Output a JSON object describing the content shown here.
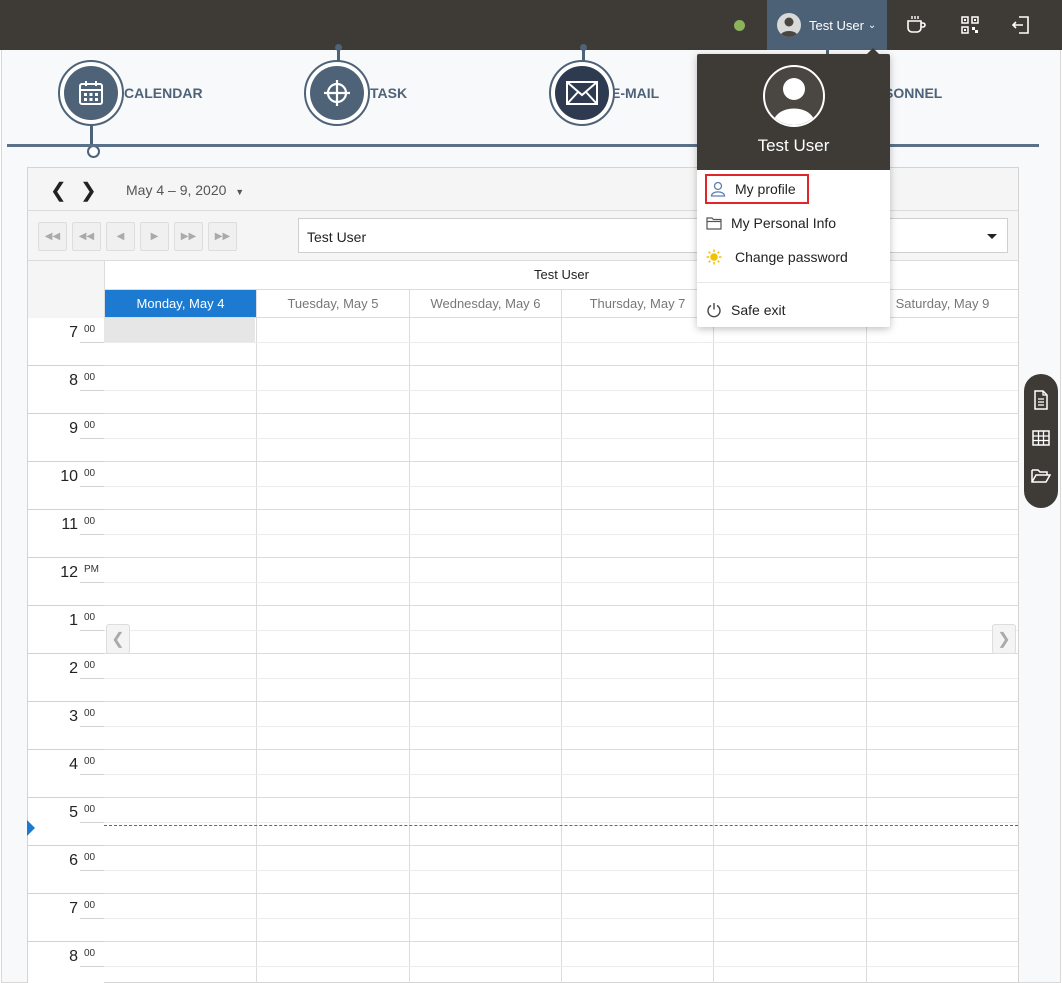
{
  "topbar": {
    "user_name": "Test User",
    "status_color": "#8bb35a",
    "icons": [
      "coffee-icon",
      "qr-code-icon",
      "logout-icon"
    ]
  },
  "modules": [
    {
      "label": "CALENDAR",
      "icon": "calendar-icon"
    },
    {
      "label": "TASK",
      "icon": "crosshair-icon"
    },
    {
      "label": "E-MAIL",
      "icon": "envelope-icon"
    },
    {
      "label": "SONNEL",
      "icon": "personnel-icon"
    }
  ],
  "scheduler": {
    "date_range": "May 4 – 9, 2020",
    "resource": "Test User",
    "group_header": "Test User",
    "days": [
      "Monday, May 4",
      "Tuesday, May 5",
      "Wednesday, May 6",
      "Thursday, May 7",
      "",
      "Saturday, May 9"
    ],
    "hours": [
      {
        "h": "7",
        "m": "00"
      },
      {
        "h": "8",
        "m": "00"
      },
      {
        "h": "9",
        "m": "00"
      },
      {
        "h": "10",
        "m": "00"
      },
      {
        "h": "11",
        "m": "00"
      },
      {
        "h": "12",
        "m": "PM"
      },
      {
        "h": "1",
        "m": "00"
      },
      {
        "h": "2",
        "m": "00"
      },
      {
        "h": "3",
        "m": "00"
      },
      {
        "h": "4",
        "m": "00"
      },
      {
        "h": "5",
        "m": "00"
      },
      {
        "h": "6",
        "m": "00"
      },
      {
        "h": "7",
        "m": "00"
      },
      {
        "h": "8",
        "m": "00"
      }
    ],
    "accent": "#1c7ad0"
  },
  "dropdown": {
    "name": "Test User",
    "items": [
      {
        "label": "My profile",
        "icon": "user-icon"
      },
      {
        "label": "My Personal Info",
        "icon": "folder-icon"
      },
      {
        "label": "Change password",
        "icon": "sun-icon"
      },
      {
        "label": "Safe exit",
        "icon": "power-icon"
      }
    ]
  },
  "side_panel": {
    "icons": [
      "document-icon",
      "table-icon",
      "folder-open-icon"
    ]
  }
}
